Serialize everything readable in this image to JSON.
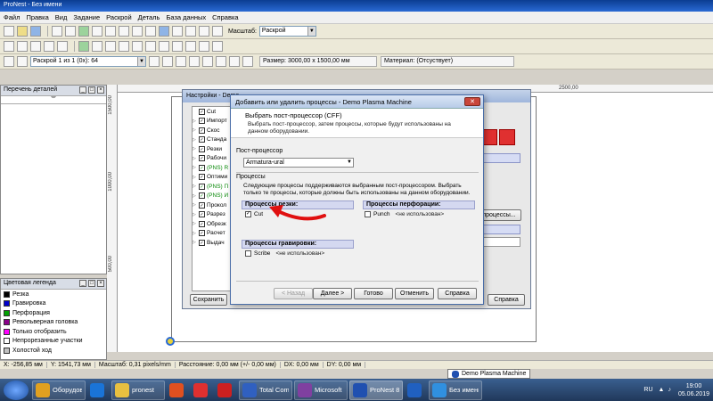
{
  "window": {
    "title": "ProNest - Без имени"
  },
  "menu": [
    "Файл",
    "Правка",
    "Вид",
    "Задание",
    "Раскрой",
    "Деталь",
    "База данных",
    "Справка"
  ],
  "toolbar1": {
    "scale_label": "Масштаб:",
    "scale_value": "Раскрой"
  },
  "toolbar3": {
    "nest_select": "Раскрой 1 из 1 (0x): 64",
    "size_label": "Размер: 3000,00 x 1500,00 мм",
    "material_label": "Материал: (Отсуствует)"
  },
  "parts_panel": {
    "title": "Перечень деталей"
  },
  "legend_panel": {
    "title": "Цветовая легенда",
    "items": [
      {
        "label": "Резка",
        "color": "#000000"
      },
      {
        "label": "Гравировка",
        "color": "#0000cc"
      },
      {
        "label": "Перфорация",
        "color": "#00a000"
      },
      {
        "label": "Револьверная головка",
        "color": "#8a008a"
      },
      {
        "label": "Только отобразить",
        "color": "#ff00ff"
      },
      {
        "label": "Непрорезанные участки",
        "color": "#ffffff"
      },
      {
        "label": "Холостой ход",
        "color": "#c0c0c0"
      }
    ]
  },
  "ruler": {
    "top": [
      "2500,00"
    ],
    "left": [
      "1500,00",
      "1000,00",
      "500,00"
    ]
  },
  "settings_window": {
    "title": "Настройки - Demo",
    "tree": [
      {
        "label": "Cut",
        "green": false
      },
      {
        "label": "Импорт",
        "green": false
      },
      {
        "label": "Скос",
        "green": false
      },
      {
        "label": "Станда",
        "green": false
      },
      {
        "label": "Резки",
        "green": false
      },
      {
        "label": "Рабочи",
        "green": false
      },
      {
        "label": "(PNS) R",
        "green": true
      },
      {
        "label": "Оптими",
        "green": false
      },
      {
        "label": "(PNS) П",
        "green": true
      },
      {
        "label": "(PNS) И",
        "green": true
      },
      {
        "label": "Прокол",
        "green": false
      },
      {
        "label": "Разрез",
        "green": false
      },
      {
        "label": "Обрезк",
        "green": false
      },
      {
        "label": "Расчет",
        "green": false
      },
      {
        "label": "Выдач",
        "green": false
      }
    ],
    "save_button": "Сохранить",
    "processes_button": "процессы...",
    "help_button": "Справка"
  },
  "dialog": {
    "title": "Добавить или удалить процессы - Demo Plasma Machine",
    "heading": "Выбрать пост-процессор (CFF)",
    "description": "Выбрать пост-процессор, затем процессы, которые будут использованы на данном оборудовании.",
    "postprocessor_label": "Пост-процессор",
    "postprocessor_value": "Armatura-ural",
    "processes_label": "Процессы",
    "processes_desc": "Следующие процессы поддерживаются выбранным пост-процессором. Выбрать только те процессы, которые должны быть использованы на данном оборудовании.",
    "cutting_header": "Процессы резки:",
    "cutting_item": "Cut",
    "perforation_header": "Процессы перфорации:",
    "perforation_item": "Punch",
    "perforation_na": "<не использован>",
    "engraving_header": "Процессы гравировки:",
    "engraving_item": "Scribe",
    "engraving_na": "<не использован>",
    "buttons": {
      "back": "< Назад",
      "next": "Далее >",
      "done": "Готово",
      "cancel": "Отменить",
      "help": "Справка"
    }
  },
  "status": {
    "x": "X: -256,85 мм",
    "y": "Y: 1541,73 мм",
    "scale": "Масштаб: 0,31 pixels/mm",
    "distance": "Расстояние: 0,00 мм (+/- 0,00 мм)",
    "dx": "DX: 0,00 мм",
    "dy": "DY: 0,00 мм"
  },
  "tooltip": "Demo Plasma Machine",
  "taskbar": [
    {
      "label": "Оборудова...",
      "color": "#e0a020"
    },
    {
      "label": "",
      "color": "#1a74d8"
    },
    {
      "label": "pronest",
      "color": "#e8c040"
    },
    {
      "label": "",
      "color": "#e05020"
    },
    {
      "label": "",
      "color": "#e03030"
    },
    {
      "label": "",
      "color": "#cc2020"
    },
    {
      "label": "Total Com...",
      "color": "#3060c0"
    },
    {
      "label": "Microsoft F...",
      "color": "#8040a0"
    },
    {
      "label": "ProNest 8",
      "color": "#2050b0"
    },
    {
      "label": "",
      "color": "#2060c0"
    },
    {
      "label": "Без имени...",
      "color": "#3090e0"
    }
  ],
  "tray": {
    "lang": "RU",
    "time": "19:00",
    "date": "05.06.2019"
  }
}
